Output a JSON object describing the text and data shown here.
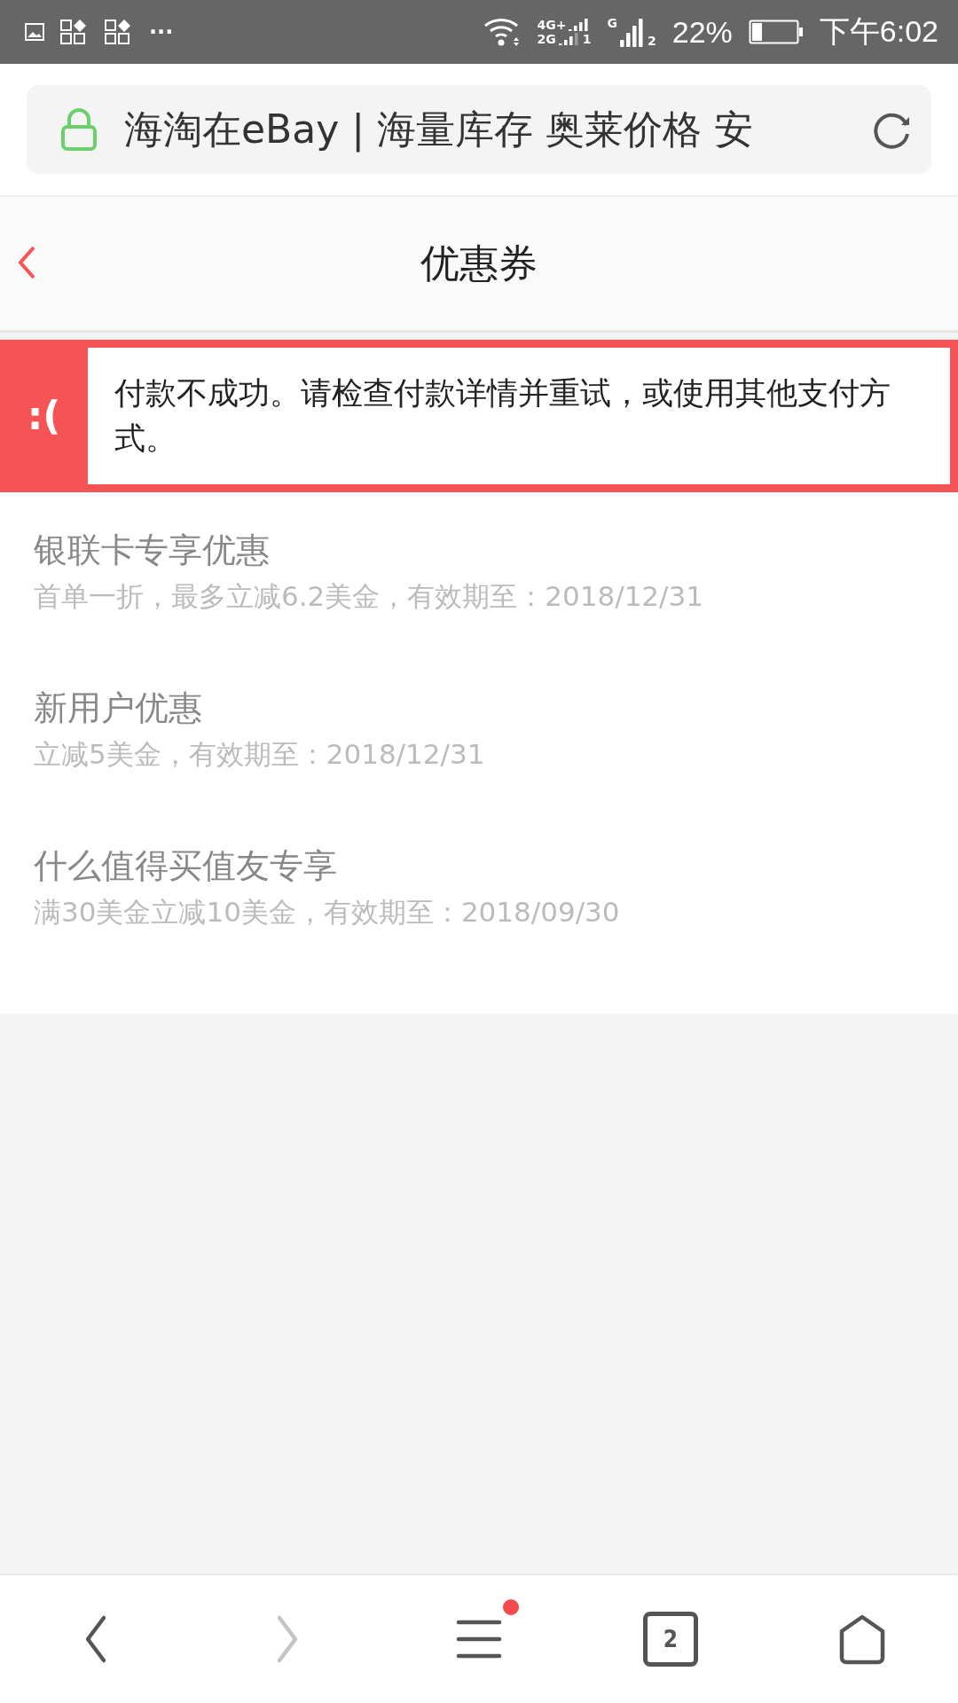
{
  "status_bar": {
    "overflow": "···",
    "network_1_top": "4G+",
    "network_1_bottom": "2G",
    "sim_1": "1",
    "network_2": "G",
    "sim_2": "2",
    "battery_percent": "22%",
    "time": "下午6:02"
  },
  "address_bar": {
    "secure": true,
    "title": "海淘在eBay | 海量库存 奥莱价格 安"
  },
  "header": {
    "title": "优惠券"
  },
  "error_banner": {
    "face": ":(",
    "message": "付款不成功。请检查付款详情并重试，或使用其他支付方式。"
  },
  "coupons": [
    {
      "title": "银联卡专享优惠",
      "detail": "首单一折，最多立减6.2美金，有效期至：2018/12/31"
    },
    {
      "title": "新用户优惠",
      "detail": "立减5美金，有效期至：2018/12/31"
    },
    {
      "title": "什么值得买值友专享",
      "detail": "满30美金立减10美金，有效期至：2018/09/30"
    }
  ],
  "bottom_nav": {
    "back_enabled": true,
    "forward_enabled": false,
    "menu_badge": true,
    "tab_count": "2"
  }
}
